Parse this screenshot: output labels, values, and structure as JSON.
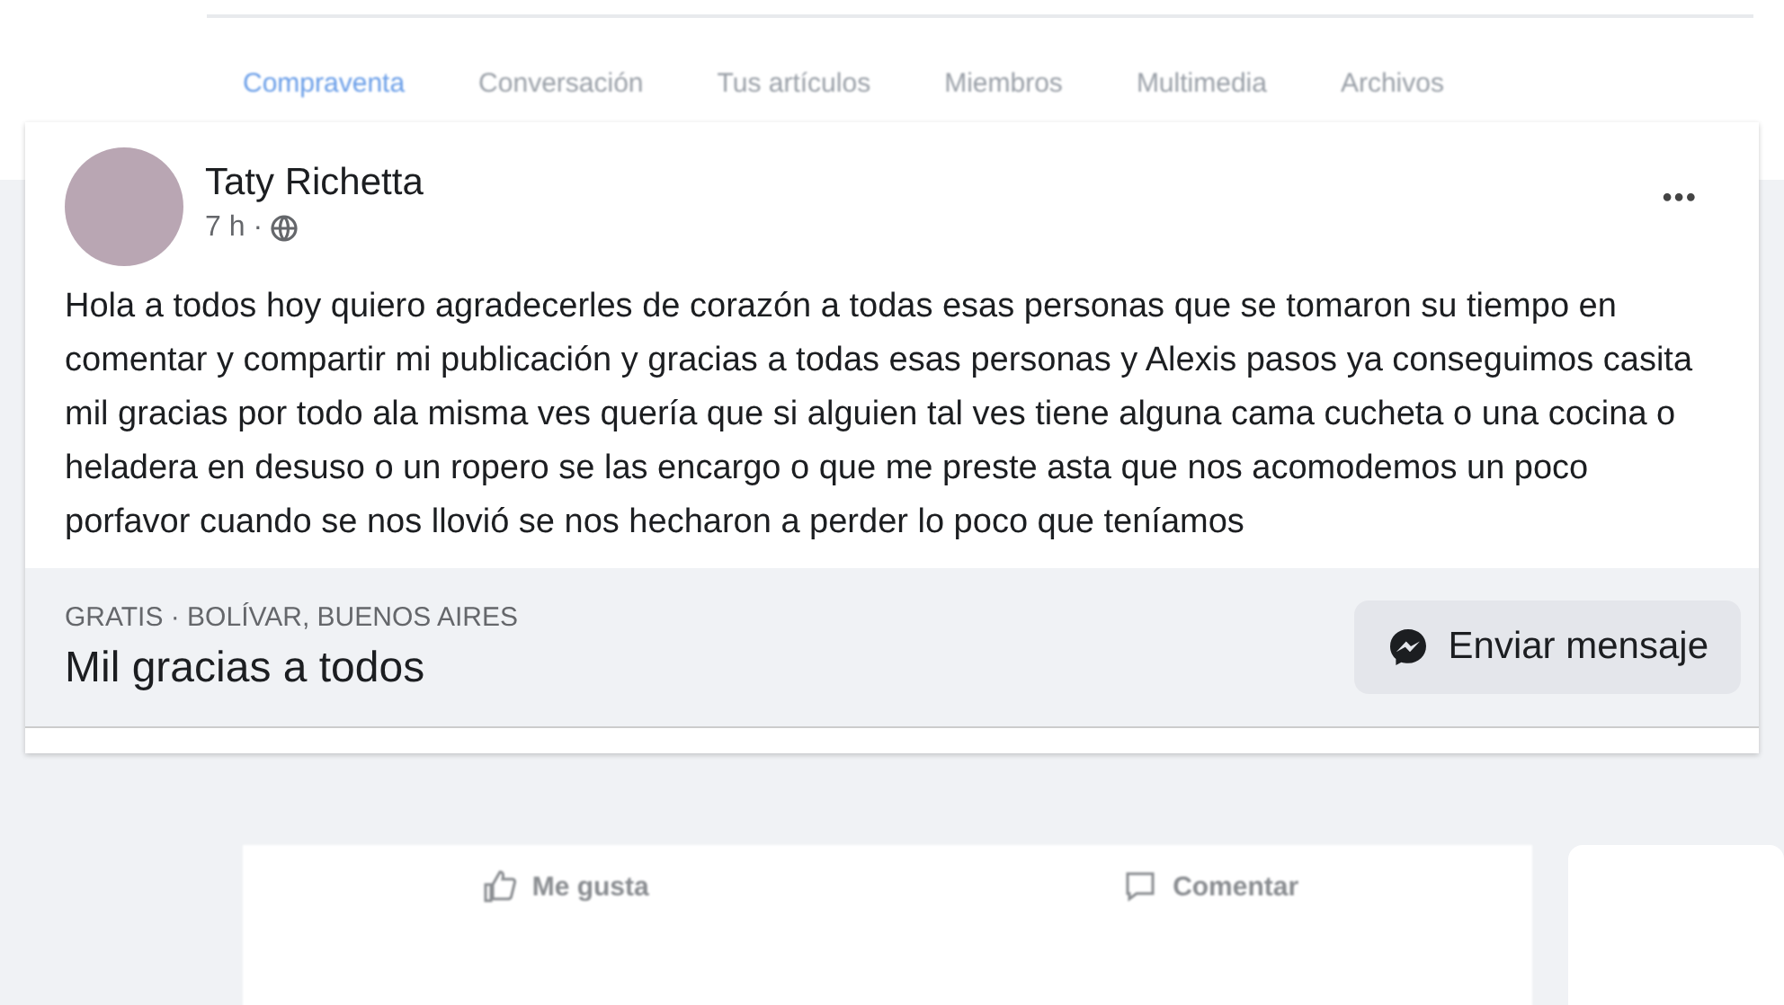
{
  "tabs": [
    {
      "label": "Compraventa",
      "selected": true
    },
    {
      "label": "Conversación",
      "selected": false
    },
    {
      "label": "Tus artículos",
      "selected": false
    },
    {
      "label": "Miembros",
      "selected": false
    },
    {
      "label": "Multimedia",
      "selected": false
    },
    {
      "label": "Archivos",
      "selected": false
    }
  ],
  "post": {
    "author": "Taty Richetta",
    "time": "7 h ·",
    "more": "•••",
    "text": "Hola a todos hoy quiero agradecerles de corazón a todas esas personas que se tomaron su tiempo en comentar y compartir mi publicación y gracias a todas esas personas y Alexis pasos ya conseguimos casita mil gracias por todo ala misma ves quería que si alguien tal ves tiene alguna cama cucheta o una cocina o heladera  en desuso o un ropero se las encargo o que me preste asta que nos acomodemos un poco porfavor cuando se nos llovió se nos hecharon a perder lo poco que teníamos",
    "listing_meta": "GRATIS · BOLÍVAR, BUENOS AIRES",
    "listing_title": "Mil gracias a todos",
    "message_button": "Enviar mensaje"
  },
  "actions": [
    "Me gusta",
    "Comentar"
  ]
}
